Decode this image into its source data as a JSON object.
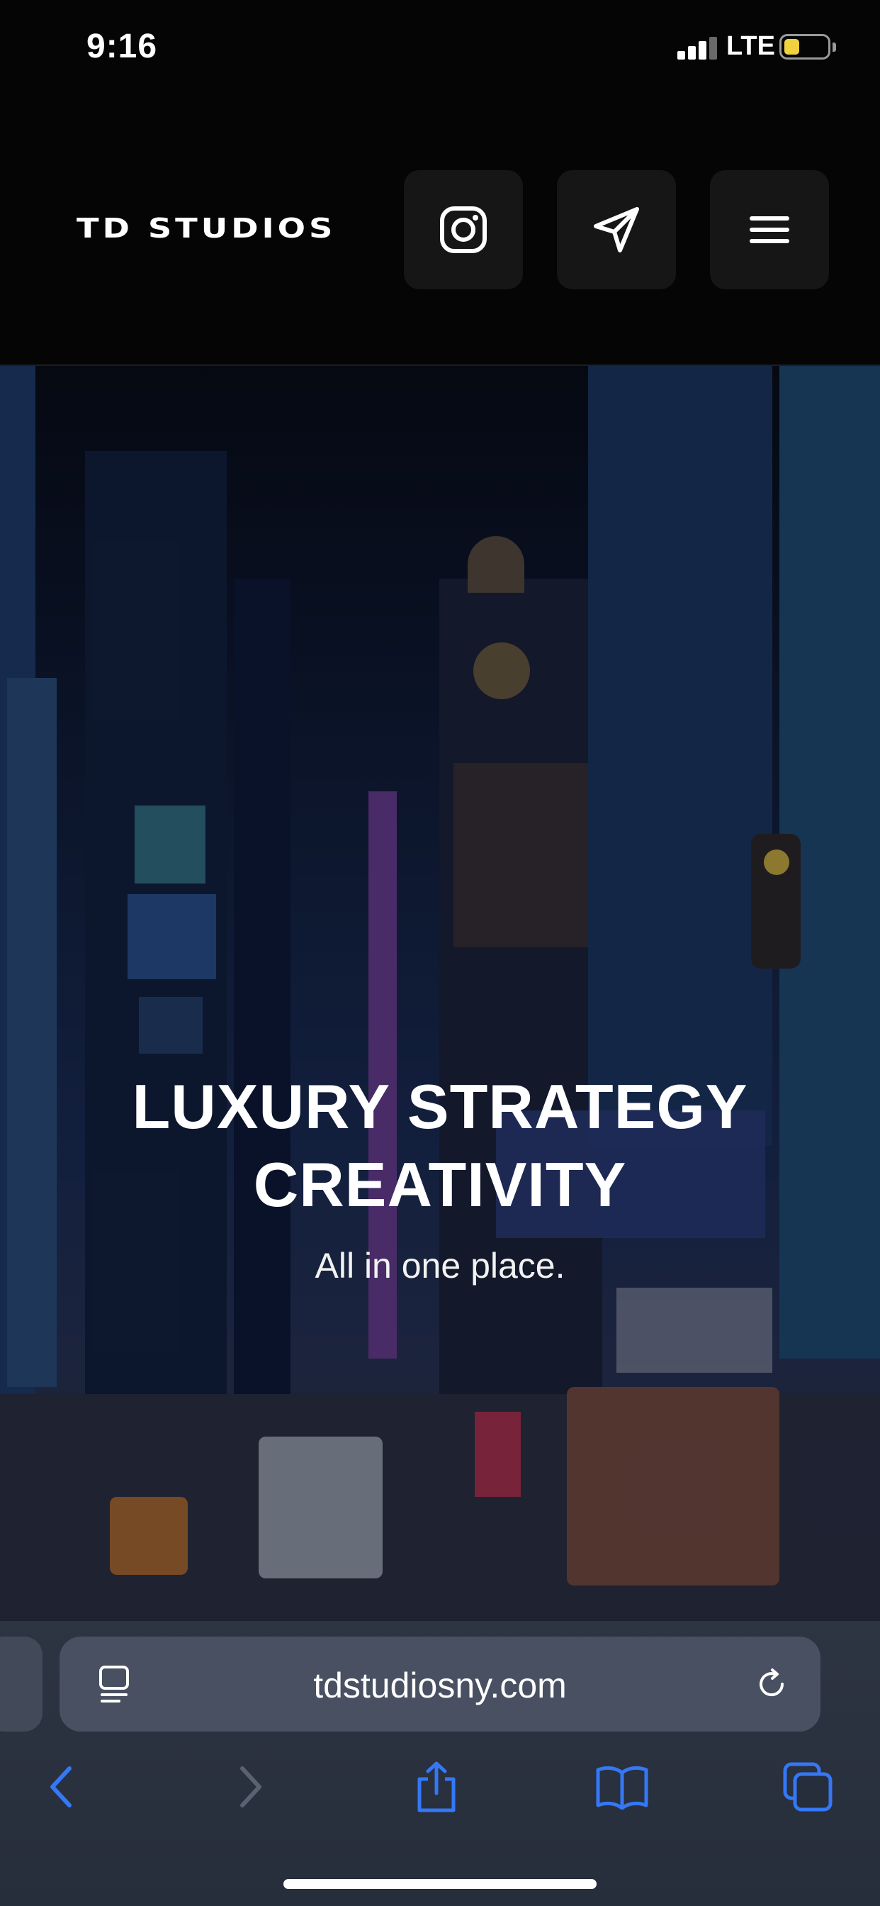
{
  "status_bar": {
    "time": "9:16",
    "network": "LTE",
    "signal_bars_filled": 3,
    "signal_bars_total": 4,
    "battery_level": 0.35,
    "battery_color": "#f0d13f"
  },
  "header": {
    "brand": "TD STUDIOS",
    "buttons": [
      {
        "icon": "instagram-icon"
      },
      {
        "icon": "send-icon"
      },
      {
        "icon": "menu-icon"
      }
    ]
  },
  "hero": {
    "title_line1": "LUXURY STRATEGY",
    "title_line2": "CREATIVITY",
    "subtitle": "All in one place."
  },
  "browser": {
    "url": "tdstudiosny.com",
    "accent_color": "#3478f6",
    "toolbar": [
      "back-icon",
      "forward-icon",
      "share-icon",
      "bookmarks-icon",
      "tabs-icon"
    ]
  }
}
